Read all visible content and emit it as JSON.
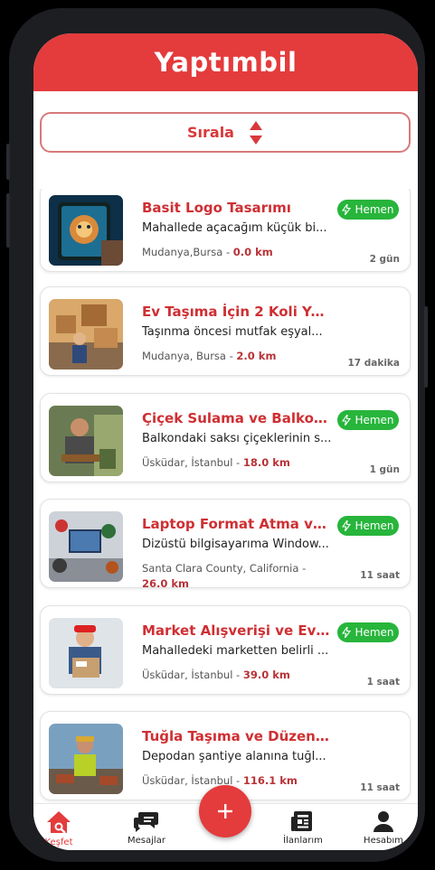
{
  "header": {
    "title": "Yaptımbil"
  },
  "sort": {
    "label": "Sırala",
    "icon": "sort-arrows-icon"
  },
  "listings": [
    {
      "title": "Basit Logo Tasarımı",
      "description": "Mahallede açacağım küçük bi...",
      "location": "Mudanya,Bursa - ",
      "distance": "0.0 km",
      "time": "2 gün",
      "badge": "Hemen"
    },
    {
      "title": "Ev Taşıma İçin 2 Koli Yar...",
      "description": "Taşınma öncesi mutfak eşyal...",
      "location": "Mudanya, Bursa - ",
      "distance": "2.0 km",
      "time": "17 dakika",
      "badge": ""
    },
    {
      "title": "Çiçek Sulama ve Balkon ...",
      "description": "Balkondaki saksı çiçeklerinin s...",
      "location": "Üsküdar, İstanbul - ",
      "distance": "18.0 km",
      "time": "1 gün",
      "badge": "Hemen"
    },
    {
      "title": "Laptop Format Atma ve ...",
      "description": "Dizüstü bilgisayarıma Window...",
      "location": "Santa Clara County, California - ",
      "distance": "26.0 km",
      "time": "11 saat",
      "badge": "Hemen"
    },
    {
      "title": "Market Alışverişi ve Eve ...",
      "description": "Mahalledeki marketten belirli ...",
      "location": "Üsküdar, İstanbul - ",
      "distance": "39.0 km",
      "time": "1 saat",
      "badge": "Hemen"
    },
    {
      "title": "Tuğla Taşıma ve Düzenl...",
      "description": "Depodan şantiye alanına tuğl...",
      "location": "Üsküdar, İstanbul - ",
      "distance": "116.1 km",
      "time": "11 saat",
      "badge": ""
    }
  ],
  "fab": {
    "label": "+"
  },
  "nav": {
    "kesfet": "Keşfet",
    "mesajlar": "Mesajlar",
    "ilanlarim": "İlanlarım",
    "hesabim": "Hesabım"
  },
  "colors": {
    "primary": "#e43b3c",
    "badge": "#27b53b",
    "title": "#cf2f33"
  }
}
